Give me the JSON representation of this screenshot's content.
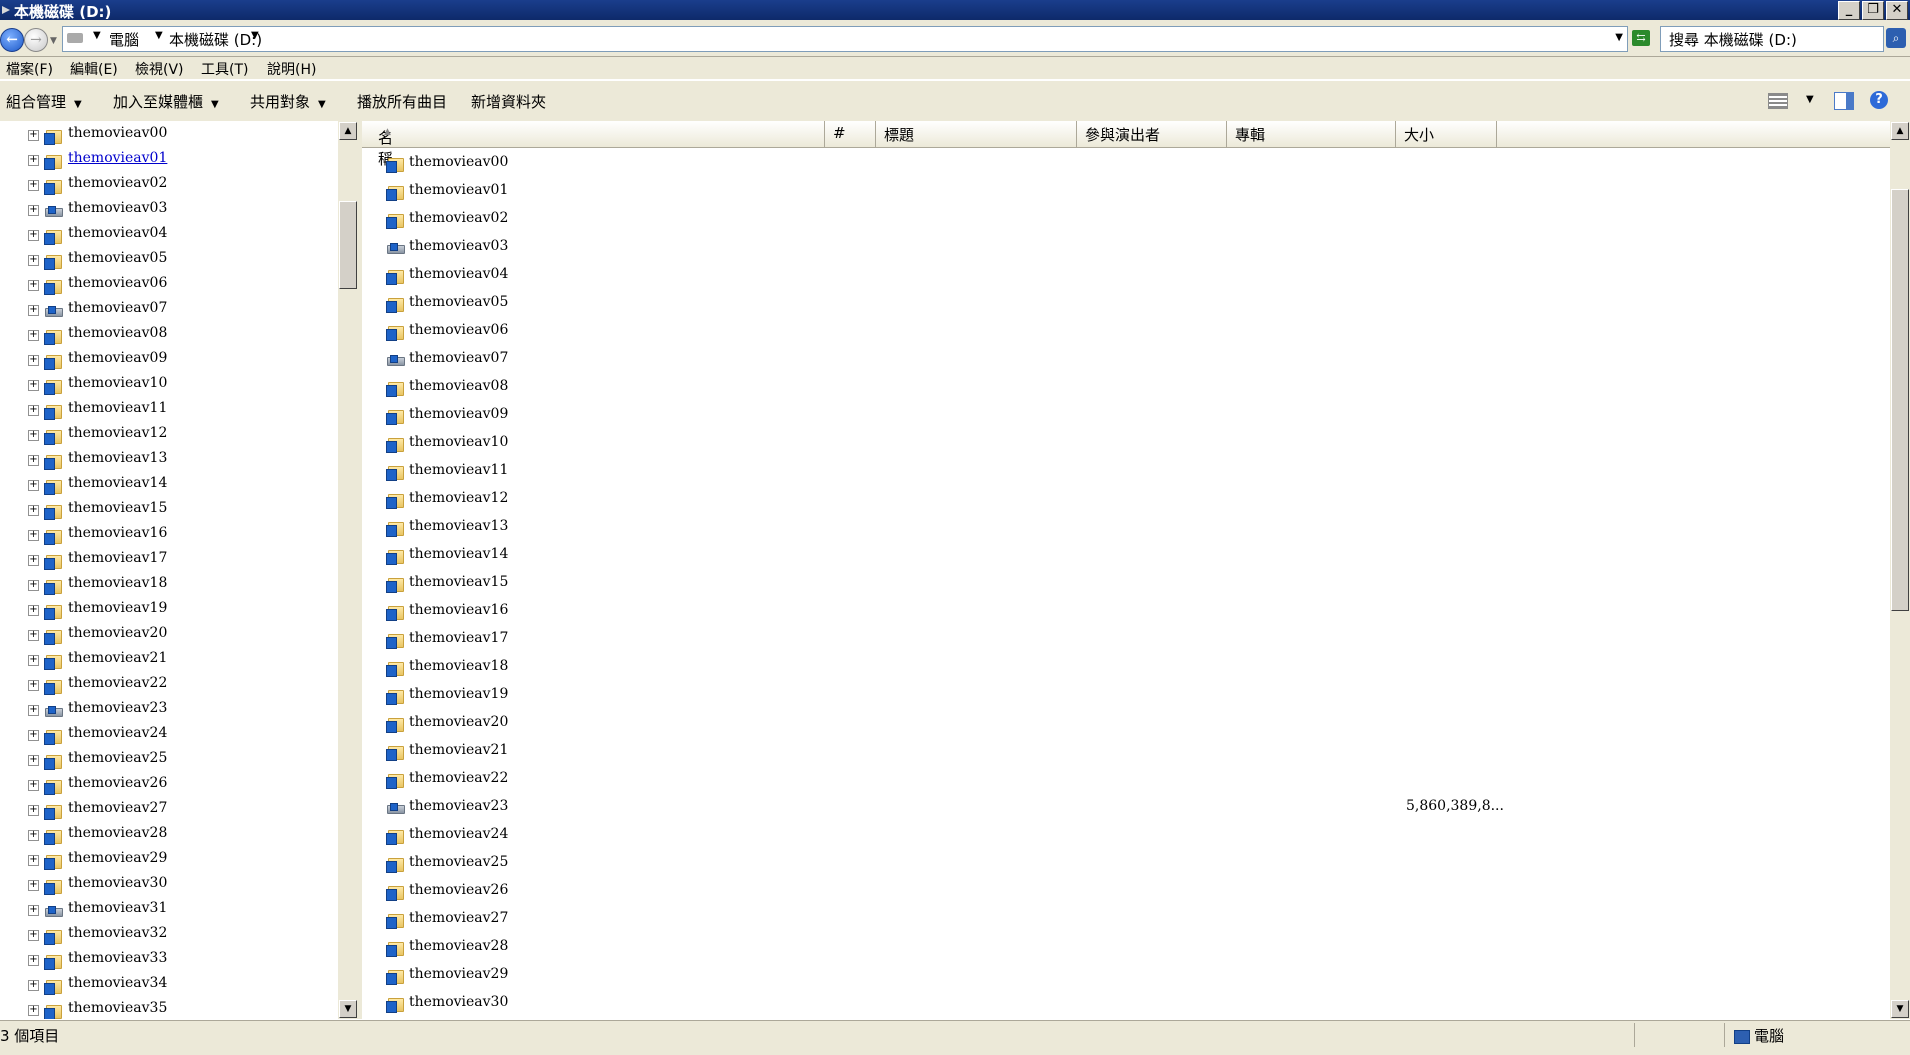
{
  "window": {
    "title": "本機磁碟 (D:)"
  },
  "address": {
    "segments": [
      "電腦",
      "本機磁碟 (D:)"
    ],
    "search_placeholder": "搜尋 本機磁碟 (D:)"
  },
  "menu": [
    "檔案(F)",
    "編輯(E)",
    "檢視(V)",
    "工具(T)",
    "說明(H)"
  ],
  "toolbar": {
    "organize": "組合管理",
    "add_to_library": "加入至媒體櫃",
    "share_with": "共用對象",
    "play_all": "播放所有曲目",
    "new_folder": "新增資料夾"
  },
  "columns": {
    "name": "名稱",
    "number": "#",
    "title": "標題",
    "artist": "參與演出者",
    "album": "專輯",
    "size": "大小"
  },
  "tree_items": [
    {
      "label": "themovieav00",
      "icon": "folder"
    },
    {
      "label": "themovieav01",
      "icon": "folder",
      "hover": true
    },
    {
      "label": "themovieav02",
      "icon": "folder"
    },
    {
      "label": "themovieav03",
      "icon": "drive"
    },
    {
      "label": "themovieav04",
      "icon": "folder"
    },
    {
      "label": "themovieav05",
      "icon": "folder"
    },
    {
      "label": "themovieav06",
      "icon": "folder"
    },
    {
      "label": "themovieav07",
      "icon": "drive"
    },
    {
      "label": "themovieav08",
      "icon": "folder"
    },
    {
      "label": "themovieav09",
      "icon": "folder"
    },
    {
      "label": "themovieav10",
      "icon": "folder"
    },
    {
      "label": "themovieav11",
      "icon": "folder"
    },
    {
      "label": "themovieav12",
      "icon": "folder"
    },
    {
      "label": "themovieav13",
      "icon": "folder"
    },
    {
      "label": "themovieav14",
      "icon": "folder"
    },
    {
      "label": "themovieav15",
      "icon": "folder"
    },
    {
      "label": "themovieav16",
      "icon": "folder"
    },
    {
      "label": "themovieav17",
      "icon": "folder"
    },
    {
      "label": "themovieav18",
      "icon": "folder"
    },
    {
      "label": "themovieav19",
      "icon": "folder"
    },
    {
      "label": "themovieav20",
      "icon": "folder"
    },
    {
      "label": "themovieav21",
      "icon": "folder"
    },
    {
      "label": "themovieav22",
      "icon": "folder"
    },
    {
      "label": "themovieav23",
      "icon": "drive"
    },
    {
      "label": "themovieav24",
      "icon": "folder"
    },
    {
      "label": "themovieav25",
      "icon": "folder"
    },
    {
      "label": "themovieav26",
      "icon": "folder"
    },
    {
      "label": "themovieav27",
      "icon": "folder"
    },
    {
      "label": "themovieav28",
      "icon": "folder"
    },
    {
      "label": "themovieav29",
      "icon": "folder"
    },
    {
      "label": "themovieav30",
      "icon": "folder"
    },
    {
      "label": "themovieav31",
      "icon": "drive"
    },
    {
      "label": "themovieav32",
      "icon": "folder"
    },
    {
      "label": "themovieav33",
      "icon": "folder"
    },
    {
      "label": "themovieav34",
      "icon": "folder"
    },
    {
      "label": "themovieav35",
      "icon": "folder"
    }
  ],
  "list_items": [
    {
      "name": "themovieav00",
      "icon": "folder",
      "size": ""
    },
    {
      "name": "themovieav01",
      "icon": "folder",
      "size": ""
    },
    {
      "name": "themovieav02",
      "icon": "folder",
      "size": ""
    },
    {
      "name": "themovieav03",
      "icon": "drive",
      "size": ""
    },
    {
      "name": "themovieav04",
      "icon": "folder",
      "size": ""
    },
    {
      "name": "themovieav05",
      "icon": "folder",
      "size": ""
    },
    {
      "name": "themovieav06",
      "icon": "folder",
      "size": ""
    },
    {
      "name": "themovieav07",
      "icon": "drive",
      "size": ""
    },
    {
      "name": "themovieav08",
      "icon": "folder",
      "size": ""
    },
    {
      "name": "themovieav09",
      "icon": "folder",
      "size": ""
    },
    {
      "name": "themovieav10",
      "icon": "folder",
      "size": ""
    },
    {
      "name": "themovieav11",
      "icon": "folder",
      "size": ""
    },
    {
      "name": "themovieav12",
      "icon": "folder",
      "size": ""
    },
    {
      "name": "themovieav13",
      "icon": "folder",
      "size": ""
    },
    {
      "name": "themovieav14",
      "icon": "folder",
      "size": ""
    },
    {
      "name": "themovieav15",
      "icon": "folder",
      "size": ""
    },
    {
      "name": "themovieav16",
      "icon": "folder",
      "size": ""
    },
    {
      "name": "themovieav17",
      "icon": "folder",
      "size": ""
    },
    {
      "name": "themovieav18",
      "icon": "folder",
      "size": ""
    },
    {
      "name": "themovieav19",
      "icon": "folder",
      "size": ""
    },
    {
      "name": "themovieav20",
      "icon": "folder",
      "size": ""
    },
    {
      "name": "themovieav21",
      "icon": "folder",
      "size": ""
    },
    {
      "name": "themovieav22",
      "icon": "folder",
      "size": ""
    },
    {
      "name": "themovieav23",
      "icon": "drive",
      "size": "5,860,389,8..."
    },
    {
      "name": "themovieav24",
      "icon": "folder",
      "size": ""
    },
    {
      "name": "themovieav25",
      "icon": "folder",
      "size": ""
    },
    {
      "name": "themovieav26",
      "icon": "folder",
      "size": ""
    },
    {
      "name": "themovieav27",
      "icon": "folder",
      "size": ""
    },
    {
      "name": "themovieav28",
      "icon": "folder",
      "size": ""
    },
    {
      "name": "themovieav29",
      "icon": "folder",
      "size": ""
    },
    {
      "name": "themovieav30",
      "icon": "folder",
      "size": ""
    }
  ],
  "status": {
    "item_count": "3 個項目",
    "location": "電腦"
  },
  "colors": {
    "titlebar": "#1a3e8c",
    "chrome": "#ece9d8",
    "link": "#0000cc"
  }
}
